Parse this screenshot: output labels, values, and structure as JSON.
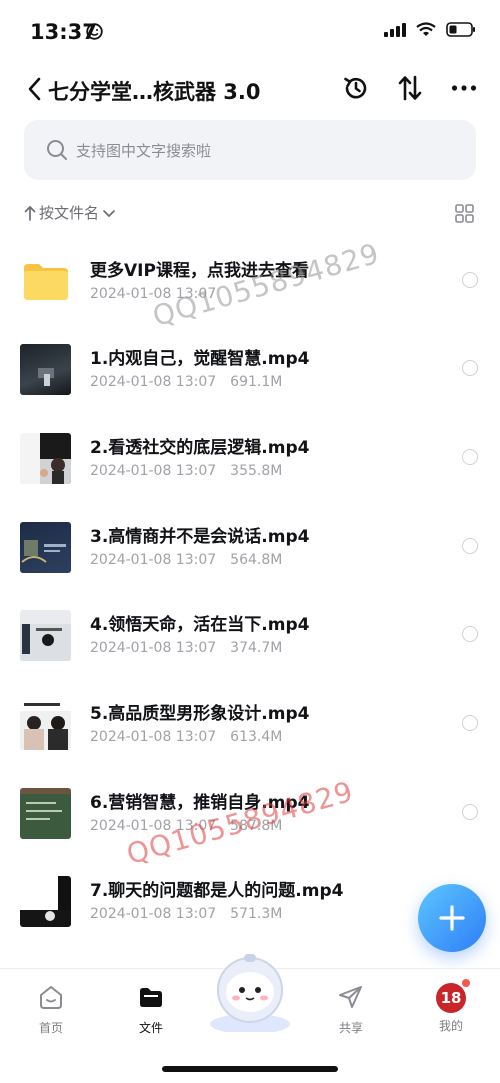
{
  "status": {
    "time": "13:37"
  },
  "nav": {
    "title": "七分学堂…核武器 3.0"
  },
  "search": {
    "placeholder": "支持图中文字搜索啦"
  },
  "sort": {
    "label": "按文件名"
  },
  "files": [
    {
      "name": "更多VIP课程，点我进去查看",
      "date": "2024-01-08 13:07",
      "size": "",
      "type": "folder"
    },
    {
      "name": "1.内观自己，觉醒智慧.mp4",
      "date": "2024-01-08 13:07",
      "size": "691.1M",
      "type": "video",
      "thumb": "dark"
    },
    {
      "name": "2.看透社交的底层逻辑.mp4",
      "date": "2024-01-08 13:07",
      "size": "355.8M",
      "type": "video",
      "thumb": "people"
    },
    {
      "name": "3.高情商并不是会说话.mp4",
      "date": "2024-01-08 13:07",
      "size": "564.8M",
      "type": "video",
      "thumb": "navy"
    },
    {
      "name": "4.领悟天命，活在当下.mp4",
      "date": "2024-01-08 13:07",
      "size": "374.7M",
      "type": "video",
      "thumb": "light"
    },
    {
      "name": "5.高品质型男形象设计.mp4",
      "date": "2024-01-08 13:07",
      "size": "613.4M",
      "type": "video",
      "thumb": "duo"
    },
    {
      "name": "6.营销智慧，推销自身.mp4",
      "date": "2024-01-08 13:07",
      "size": "587.8M",
      "type": "video",
      "thumb": "board"
    },
    {
      "name": "7.聊天的问题都是人的问题.mp4",
      "date": "2024-01-08 13:07",
      "size": "571.3M",
      "type": "video",
      "thumb": "split"
    }
  ],
  "watermarks": [
    "QQ1055894829",
    "QQ1055894829"
  ],
  "tabs": [
    {
      "label": "首页",
      "icon": "home-icon"
    },
    {
      "label": "文件",
      "icon": "folder-icon"
    },
    {
      "label": "共享",
      "icon": "send-icon"
    },
    {
      "label": "我的",
      "icon": "avatar-icon"
    }
  ],
  "profile_badge": "18",
  "colors": {
    "accent": "#2f7df6",
    "folder": "#f7cc4f"
  }
}
